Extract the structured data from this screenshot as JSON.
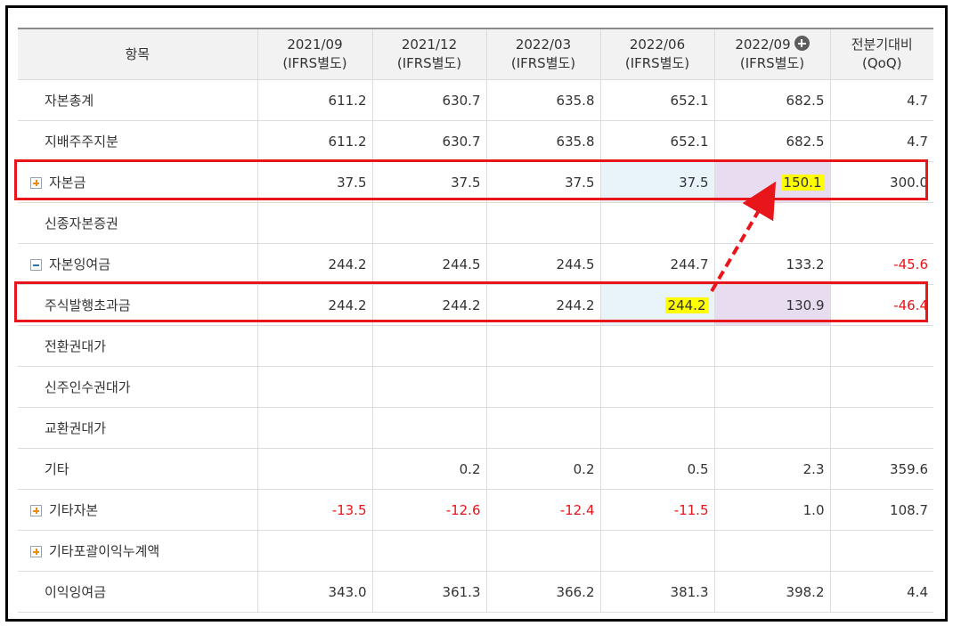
{
  "headers": {
    "item": "항목",
    "periods": [
      {
        "date": "2021/09",
        "basis": "(IFRS별도)"
      },
      {
        "date": "2021/12",
        "basis": "(IFRS별도)"
      },
      {
        "date": "2022/03",
        "basis": "(IFRS별도)"
      },
      {
        "date": "2022/06",
        "basis": "(IFRS별도)"
      },
      {
        "date": "2022/09",
        "basis": "(IFRS별도)"
      }
    ],
    "qoq_line1": "전분기대비",
    "qoq_line2": "(QoQ)"
  },
  "rows": [
    {
      "label": "자본총계",
      "values": [
        "611.2",
        "630.7",
        "635.8",
        "652.1",
        "682.5",
        "4.7"
      ]
    },
    {
      "label": "지배주주지분",
      "values": [
        "611.2",
        "630.7",
        "635.8",
        "652.1",
        "682.5",
        "4.7"
      ]
    },
    {
      "label": "자본금",
      "values": [
        "37.5",
        "37.5",
        "37.5",
        "37.5",
        "150.1",
        "300.0"
      ]
    },
    {
      "label": "신종자본증권",
      "values": [
        "",
        "",
        "",
        "",
        "",
        ""
      ]
    },
    {
      "label": "자본잉여금",
      "values": [
        "244.2",
        "244.5",
        "244.5",
        "244.7",
        "133.2",
        "-45.6"
      ]
    },
    {
      "label": "주식발행초과금",
      "values": [
        "244.2",
        "244.2",
        "244.2",
        "244.2",
        "130.9",
        "-46.4"
      ]
    },
    {
      "label": "전환권대가",
      "values": [
        "",
        "",
        "",
        "",
        "",
        ""
      ]
    },
    {
      "label": "신주인수권대가",
      "values": [
        "",
        "",
        "",
        "",
        "",
        ""
      ]
    },
    {
      "label": "교환권대가",
      "values": [
        "",
        "",
        "",
        "",
        "",
        ""
      ]
    },
    {
      "label": "기타",
      "values": [
        "",
        "0.2",
        "0.2",
        "0.5",
        "2.3",
        "359.6"
      ]
    },
    {
      "label": "기타자본",
      "values": [
        "-13.5",
        "-12.6",
        "-12.4",
        "-11.5",
        "1.0",
        "108.7"
      ]
    },
    {
      "label": "기타포괄이익누계액",
      "values": [
        "",
        "",
        "",
        "",
        "",
        ""
      ]
    },
    {
      "label": "이익잉여금",
      "values": [
        "343.0",
        "361.3",
        "366.2",
        "381.3",
        "398.2",
        "4.4"
      ]
    }
  ],
  "colors": {
    "annotation_red": "#e8151b",
    "highlight_yellow": "#ffff00",
    "negative": "#e8151b"
  }
}
